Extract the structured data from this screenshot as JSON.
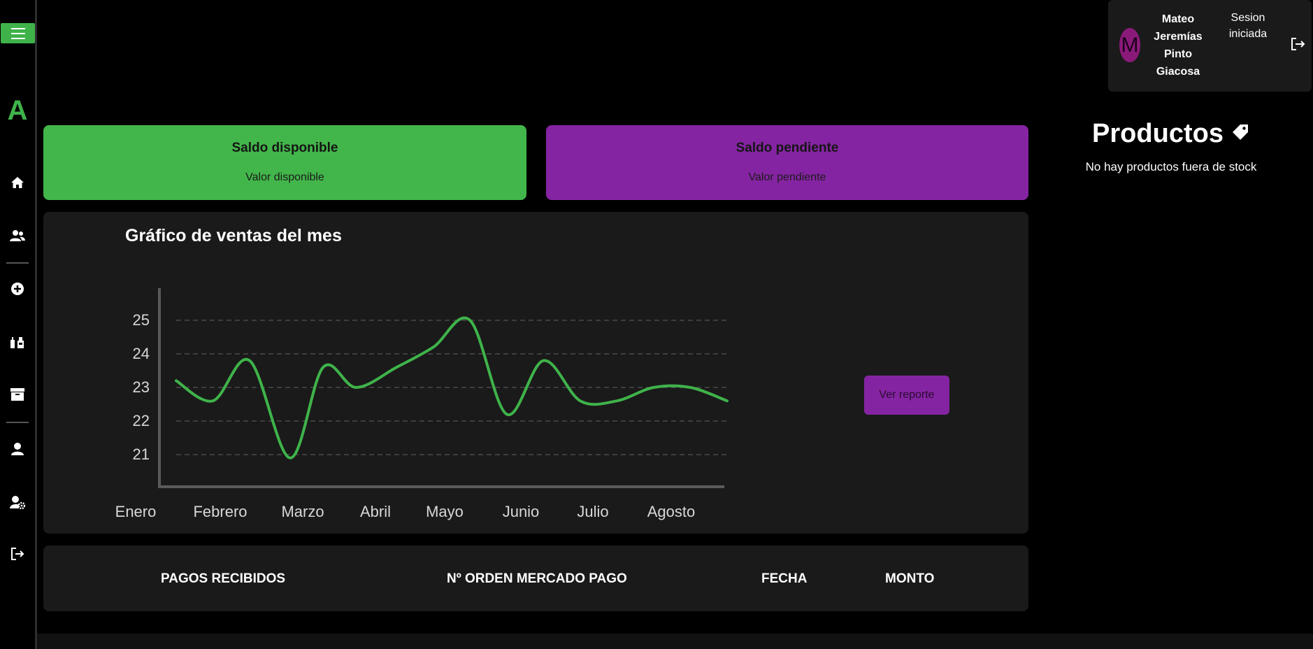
{
  "sidebar": {
    "brand": "A",
    "items": [
      {
        "icon": "home-icon"
      },
      {
        "icon": "users-icon"
      },
      {
        "icon": "add-circle-icon"
      },
      {
        "icon": "products-icon"
      },
      {
        "icon": "archive-icon"
      },
      {
        "icon": "profile-icon"
      },
      {
        "icon": "user-settings-icon"
      },
      {
        "icon": "logout-icon"
      }
    ]
  },
  "user": {
    "avatar_letter": "M",
    "name": "Mateo Jeremías Pinto Giacosa",
    "status": "Sesion iniciada"
  },
  "balances": {
    "available_title": "Saldo disponible",
    "available_value": "Valor disponible",
    "pending_title": "Saldo pendiente",
    "pending_value": "Valor pendiente"
  },
  "products": {
    "title": "Productos",
    "note": "No hay productos fuera de stock"
  },
  "chart": {
    "title": "Gráfico de ventas del mes",
    "report_button": "Ver reporte"
  },
  "chart_data": {
    "type": "line",
    "categories": [
      "Enero",
      "Febrero",
      "Marzo",
      "Abril",
      "Mayo",
      "Junio",
      "Julio",
      "Agosto"
    ],
    "yticks": [
      21,
      22,
      23,
      24,
      25
    ],
    "ylim": [
      20,
      26
    ],
    "grid": true,
    "series": [
      {
        "x": [
          0.0,
          0.5,
          1.0,
          1.55,
          2.0,
          2.45,
          3.0,
          3.5,
          4.0,
          4.5,
          5.0,
          5.5,
          6.0,
          6.5,
          7.0,
          7.5
        ],
        "values": [
          23.2,
          22.6,
          23.8,
          20.9,
          23.6,
          23.0,
          23.6,
          24.2,
          25.0,
          22.2,
          23.8,
          22.6,
          22.6,
          23.0,
          23.0,
          22.6
        ]
      }
    ],
    "color": "#3fb34a"
  },
  "payments": {
    "headers": [
      "PAGOS RECIBIDOS",
      "Nº ORDEN MERCADO PAGO",
      "FECHA",
      "MONTO"
    ]
  },
  "colors": {
    "accent_green": "#42b64a",
    "accent_purple": "#8524a2",
    "panel_bg": "#1a1a1a"
  }
}
